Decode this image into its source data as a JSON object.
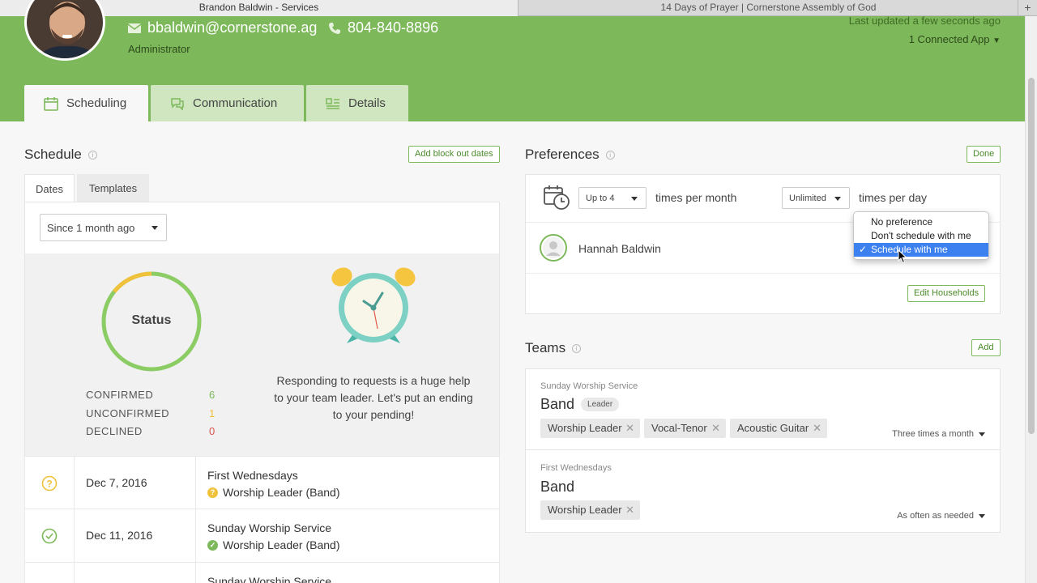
{
  "browser": {
    "tabs": [
      {
        "title": "Brandon Baldwin - Services"
      },
      {
        "title": "14 Days of Prayer | Cornerstone Assembly of God"
      }
    ],
    "new_tab_label": "+"
  },
  "profile": {
    "email": "bbaldwin@cornerstone.ag",
    "phone": "804-840-8896",
    "role": "Administrator",
    "last_updated": "Last updated a few seconds ago",
    "connected_apps": "1 Connected App"
  },
  "page_tabs": [
    {
      "label": "Scheduling",
      "icon": "calendar-icon",
      "active": true
    },
    {
      "label": "Communication",
      "icon": "chat-icon",
      "active": false
    },
    {
      "label": "Details",
      "icon": "details-icon",
      "active": false
    }
  ],
  "schedule": {
    "title": "Schedule",
    "add_block_out": "Add block out dates",
    "tabs": [
      {
        "label": "Dates"
      },
      {
        "label": "Templates"
      }
    ],
    "range_select": "Since 1 month ago",
    "status_label": "Status",
    "stats": [
      {
        "label": "CONFIRMED",
        "value": "6",
        "color": "#7db95a"
      },
      {
        "label": "UNCONFIRMED",
        "value": "1",
        "color": "#f0c23b"
      },
      {
        "label": "DECLINED",
        "value": "0",
        "color": "#d9534f"
      }
    ],
    "help_text": "Responding to requests is a huge help to your team leader. Let's put an ending to your pending!",
    "requests": [
      {
        "status": "unconfirmed",
        "date": "Dec 7, 2016",
        "service": "First Wednesdays",
        "position": "Worship Leader (Band)"
      },
      {
        "status": "confirmed",
        "date": "Dec 11, 2016",
        "service": "Sunday Worship Service",
        "position": "Worship Leader (Band)"
      },
      {
        "status": "unconfirmed",
        "date": "",
        "service": "Sunday Worship Service",
        "position": ""
      }
    ]
  },
  "preferences": {
    "title": "Preferences",
    "done": "Done",
    "per_month_select": "Up to 4",
    "per_month_label": "times per month",
    "per_day_select": "Unlimited",
    "per_day_label": "times per day",
    "household_member": "Hannah Baldwin",
    "household_options": [
      {
        "label": "No preference",
        "selected": false
      },
      {
        "label": "Don't schedule with me",
        "selected": false
      },
      {
        "label": "Schedule with me",
        "selected": true
      }
    ],
    "edit_households": "Edit Households"
  },
  "teams": {
    "title": "Teams",
    "add": "Add",
    "items": [
      {
        "service": "Sunday Worship Service",
        "team": "Band",
        "badge": "Leader",
        "positions": [
          "Worship Leader",
          "Vocal-Tenor",
          "Acoustic Guitar"
        ],
        "frequency": "Three times a month"
      },
      {
        "service": "First Wednesdays",
        "team": "Band",
        "badge": "",
        "positions": [
          "Worship Leader"
        ],
        "frequency": "As often as needed"
      }
    ]
  },
  "colors": {
    "brand_green": "#7db95a",
    "header_green": "#7db95a",
    "warning_yellow": "#f0c23b",
    "danger_red": "#d9534f",
    "select_blue": "#3d80f0"
  },
  "donut": {
    "confirmed": 6,
    "unconfirmed": 1,
    "declined": 0
  }
}
